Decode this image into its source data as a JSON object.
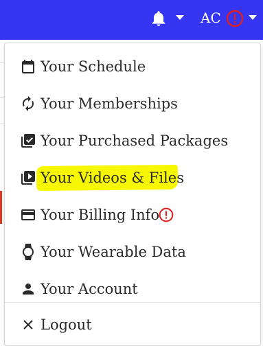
{
  "navbar": {
    "background": "#3535f2",
    "user_initials": "AC",
    "icons": [
      "bell-icon",
      "chevron-down-icon",
      "alert-circle-icon",
      "chevron-down-icon"
    ]
  },
  "menu": {
    "items": [
      {
        "label": "Your Schedule",
        "icon": "calendar-icon"
      },
      {
        "label": "Your Memberships",
        "icon": "refresh-icon"
      },
      {
        "label": "Your Purchased Packages",
        "icon": "checked-boxes-icon"
      },
      {
        "label": "Your Videos & Files",
        "icon": "video-library-icon",
        "highlighted": true
      },
      {
        "label": "Your Billing Info",
        "icon": "credit-card-icon",
        "alert": true
      },
      {
        "label": "Your Wearable Data",
        "icon": "watch-icon"
      },
      {
        "label": "Your Account",
        "icon": "person-icon"
      },
      {
        "label": "Logout",
        "icon": "close-icon"
      }
    ],
    "highlight_color": "#f7f700",
    "alert_color": "#e0201b"
  }
}
